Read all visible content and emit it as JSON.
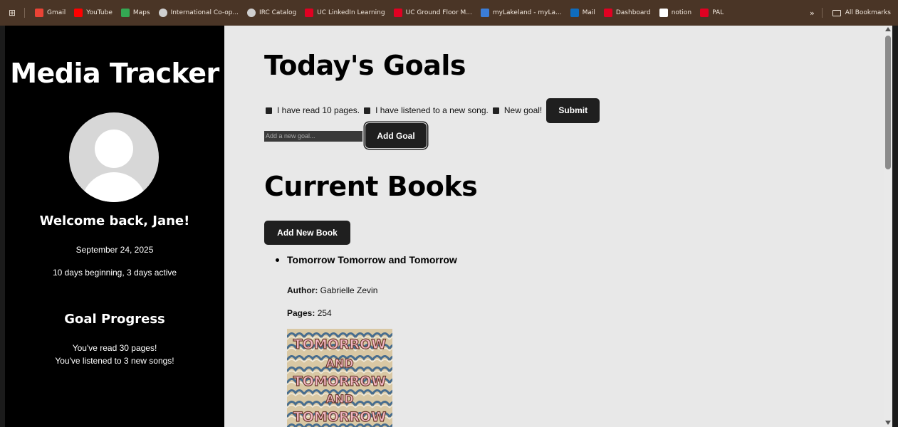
{
  "bookmarks": {
    "items": [
      {
        "label": "Gmail",
        "icon": "gmail-icon",
        "color": "#ea4335"
      },
      {
        "label": "YouTube",
        "icon": "youtube-icon",
        "color": "#ff0000"
      },
      {
        "label": "Maps",
        "icon": "maps-icon",
        "color": "#34a853"
      },
      {
        "label": "International Co-op...",
        "icon": "globe-icon",
        "color": "#cfcfcf"
      },
      {
        "label": "IRC Catalog",
        "icon": "globe-icon",
        "color": "#cfcfcf"
      },
      {
        "label": "UC LinkedIn Learning",
        "icon": "uc-icon",
        "color": "#e00122"
      },
      {
        "label": "UC Ground Floor M...",
        "icon": "uc-icon",
        "color": "#e00122"
      },
      {
        "label": "myLakeland - myLa...",
        "icon": "lakeland-icon",
        "color": "#3b7dd8"
      },
      {
        "label": "Mail",
        "icon": "outlook-icon",
        "color": "#0f6cbd"
      },
      {
        "label": "Dashboard",
        "icon": "uc-icon",
        "color": "#e00122"
      },
      {
        "label": "notion",
        "icon": "notion-icon",
        "color": "#ffffff"
      },
      {
        "label": "PAL",
        "icon": "uc-icon",
        "color": "#e00122"
      }
    ],
    "overflow": "»",
    "all_bookmarks": "All Bookmarks"
  },
  "sidebar": {
    "title": "Media Tracker",
    "welcome": "Welcome back, Jane!",
    "date": "September 24, 2025",
    "streak": "10 days beginning, 3 days active",
    "goal_progress_title": "Goal Progress",
    "progress_lines": [
      "You've read 30 pages!",
      "You've listened to 3 new songs!"
    ]
  },
  "goals": {
    "title": "Today's Goals",
    "items": [
      "I have read 10 pages.",
      "I have listened to a new song.",
      "New goal!"
    ],
    "submit_label": "Submit",
    "input_placeholder": "Add a new goal...",
    "add_goal_label": "Add Goal"
  },
  "books": {
    "title": "Current Books",
    "add_book_label": "Add New Book",
    "list": [
      {
        "title": "Tomorrow Tomorrow and Tomorrow",
        "author_label": "Author:",
        "author": "Gabrielle Zevin",
        "pages_label": "Pages:",
        "pages": "254",
        "cover_text": [
          "TOMORROW",
          "AND",
          "TOMORROW",
          "AND",
          "TOMORROW"
        ]
      }
    ]
  },
  "colors": {
    "sidebar_bg": "#000000",
    "main_bg": "#e8e8e8",
    "button_bg": "#1f1f1f",
    "bookmarks_bg": "#4a3526"
  }
}
